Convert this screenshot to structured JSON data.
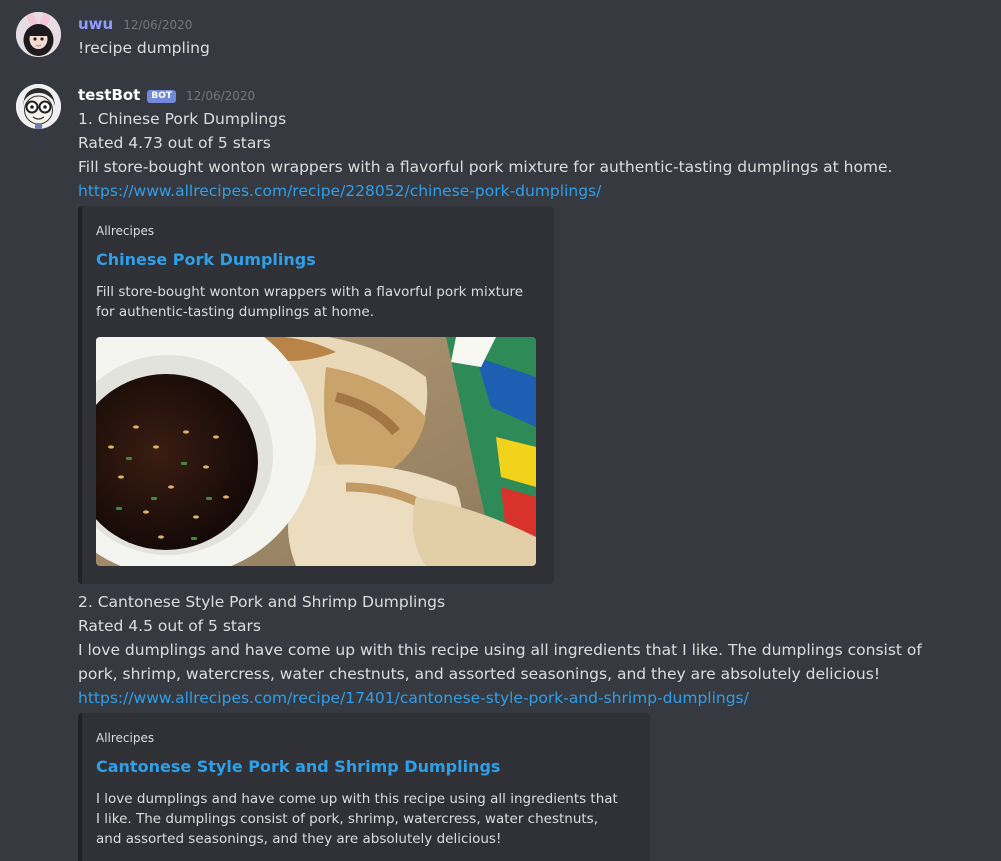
{
  "messages": [
    {
      "author": "uwu",
      "timestamp": "12/06/2020",
      "avatar": "anime-girl-bunny-ears-avatar",
      "content": "!recipe dumpling"
    },
    {
      "author": "testBot",
      "bot_tag": "BOT",
      "timestamp": "12/06/2020",
      "avatar": "cartoon-glasses-avatar",
      "recipes": [
        {
          "heading": "1. Chinese Pork Dumplings",
          "rating": "Rated 4.73 out of 5 stars",
          "description": "Fill store-bought wonton wrappers with a flavorful pork mixture for authentic-tasting dumplings at home.",
          "url": "https://www.allrecipes.com/recipe/228052/chinese-pork-dumplings/",
          "embed": {
            "provider": "Allrecipes",
            "title": "Chinese Pork Dumplings",
            "description": "Fill store-bought wonton wrappers with a flavorful pork mixture for authentic-tasting dumplings at home.",
            "image": "dumplings-with-dipping-sauce-photo"
          }
        },
        {
          "heading": "2. Cantonese Style Pork and Shrimp Dumplings",
          "rating": "Rated 4.5 out of 5 stars",
          "description": "I love dumplings and have come up with this recipe using all ingredients that I like. The dumplings consist of pork, shrimp, watercress, water chestnuts, and assorted seasonings, and they are absolutely delicious!",
          "url": "https://www.allrecipes.com/recipe/17401/cantonese-style-pork-and-shrimp-dumplings/",
          "embed": {
            "provider": "Allrecipes",
            "title": "Cantonese Style Pork and Shrimp Dumplings",
            "description": "I love dumplings and have come up with this recipe using all ingredients that I like. The dumplings consist of pork, shrimp, watercress, water chestnuts, and assorted seasonings, and they are absolutely delicious!"
          }
        }
      ]
    }
  ],
  "colors": {
    "background": "#36393f",
    "embed_background": "#2f3136",
    "link": "#2f9fe8",
    "bot_tag": "#7289da"
  }
}
